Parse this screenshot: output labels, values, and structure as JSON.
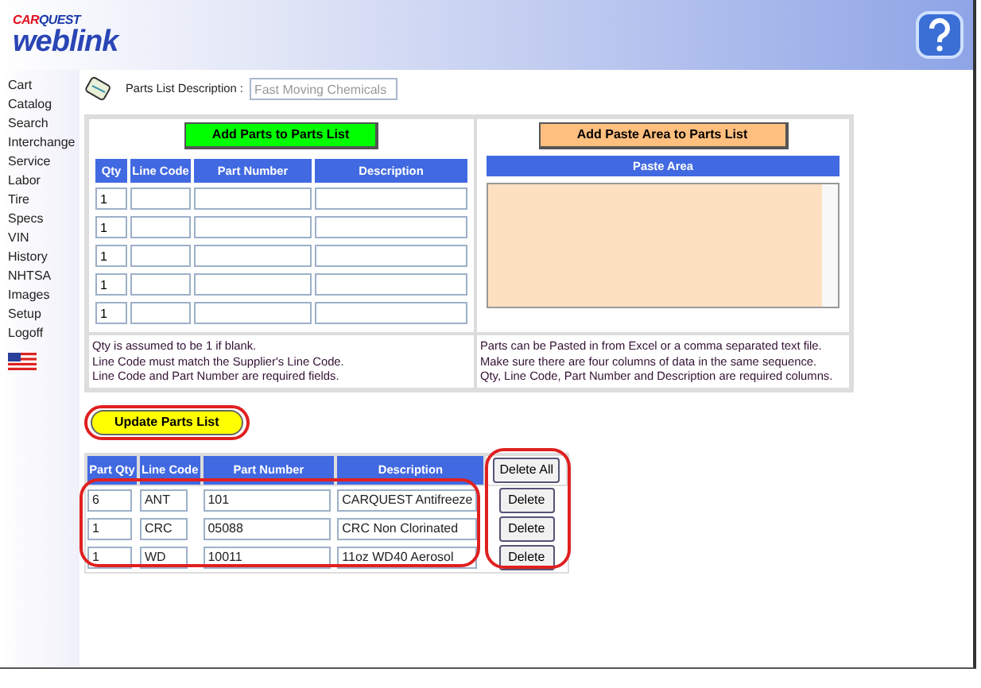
{
  "header": {
    "logo_top": [
      "CAR",
      "QUEST"
    ],
    "logo_bottom": "weblink"
  },
  "sidebar": {
    "items": [
      "Cart",
      "Catalog",
      "Search",
      "Interchange",
      "Service",
      "Labor",
      "Tire",
      "Specs",
      "VIN",
      "History",
      "NHTSA",
      "Images",
      "Setup",
      "Logoff"
    ]
  },
  "description": {
    "label": "Parts List Description :",
    "value": "Fast Moving Chemicals"
  },
  "add_parts": {
    "button": "Add Parts to Parts List",
    "columns": [
      "Qty",
      "Line Code",
      "Part Number",
      "Description"
    ],
    "rows": [
      {
        "qty": "1"
      },
      {
        "qty": "1"
      },
      {
        "qty": "1"
      },
      {
        "qty": "1"
      },
      {
        "qty": "1"
      }
    ],
    "notes": [
      "Qty is assumed to be 1 if blank.",
      "Line Code must match the Supplier's Line Code.",
      "Line Code and Part Number are required fields."
    ]
  },
  "paste": {
    "button": "Add Paste Area to Parts List",
    "heading": "Paste Area",
    "notes": [
      "Parts can be Pasted in from Excel or a comma separated text file.",
      "Make sure there are four columns of data in the same sequence.",
      "Qty, Line Code, Part Number and Description are required columns."
    ]
  },
  "update_button": "Update Parts List",
  "parts_list": {
    "columns": [
      "Part Qty",
      "Line Code",
      "Part Number",
      "Description"
    ],
    "delete_all": "Delete All",
    "rows": [
      {
        "qty": "6",
        "line_code": "ANT",
        "part_number": "101",
        "description": "CARQUEST Antifreeze",
        "delete": "Delete"
      },
      {
        "qty": "1",
        "line_code": "CRC",
        "part_number": "05088",
        "description": "CRC Non Clorinated",
        "delete": "Delete"
      },
      {
        "qty": "1",
        "line_code": "WD",
        "part_number": "10011",
        "description": "11oz WD40 Aerosol",
        "delete": "Delete"
      }
    ]
  }
}
